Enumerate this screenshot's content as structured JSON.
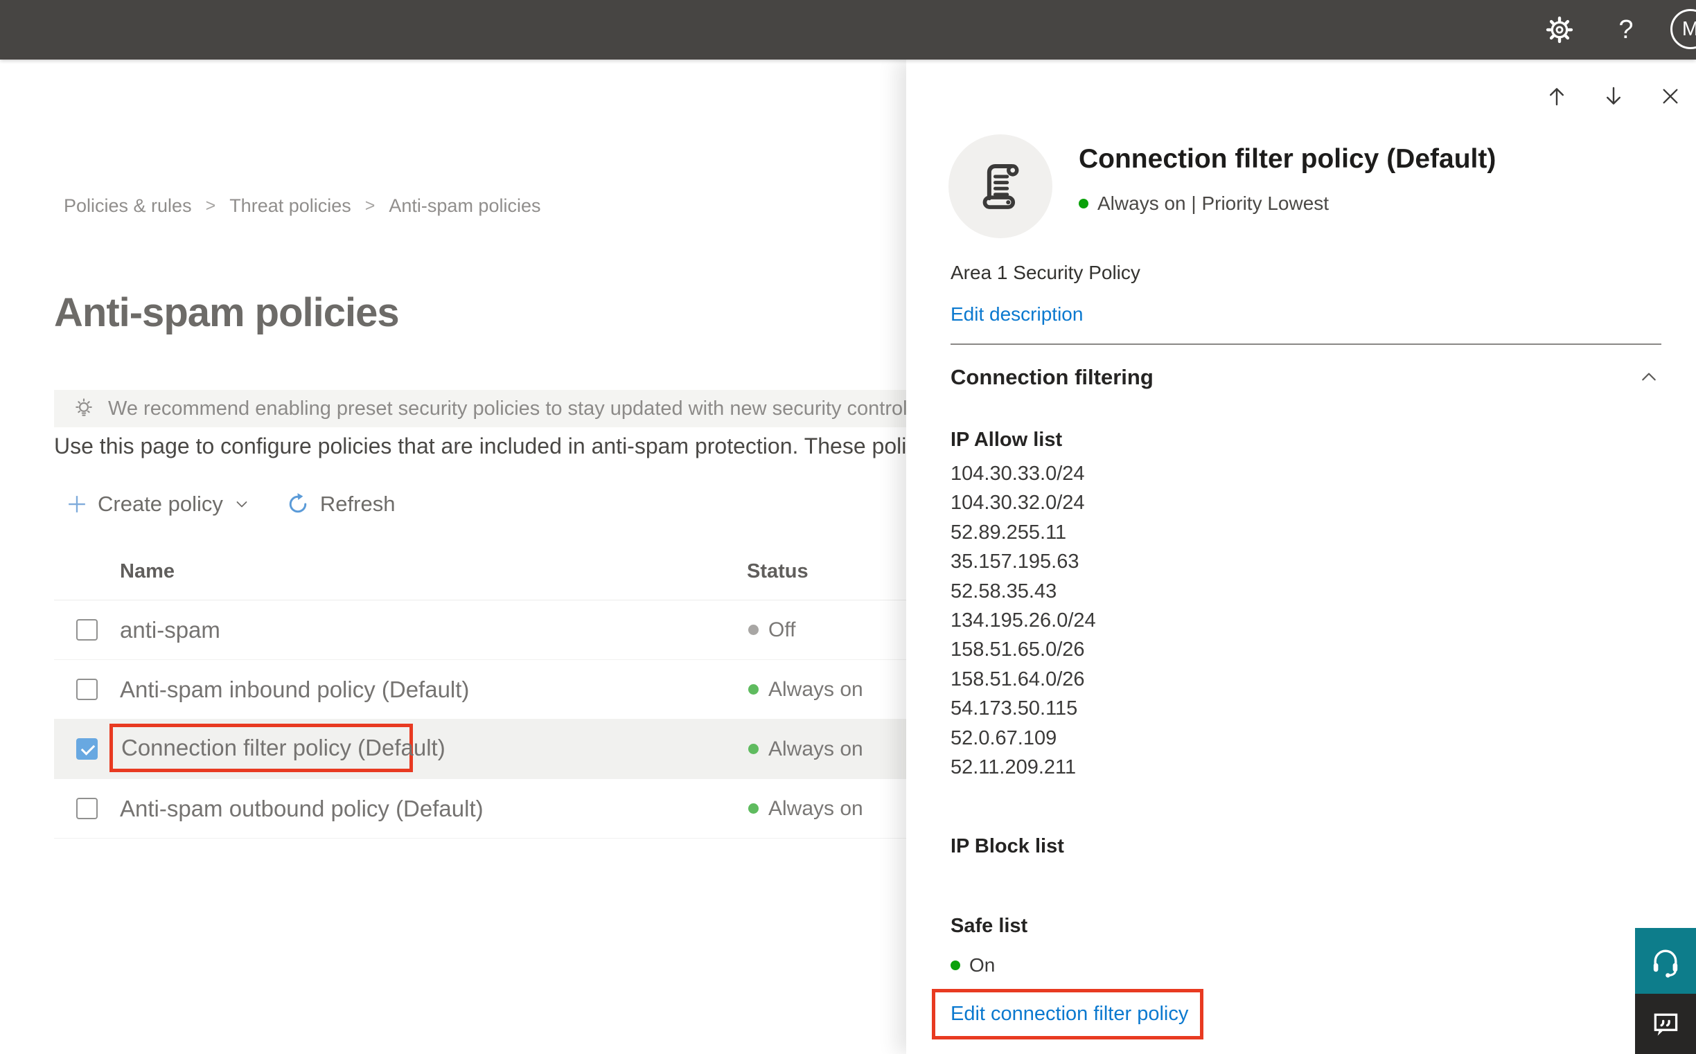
{
  "topbar": {
    "help_glyph": "?",
    "avatar_initial": "M"
  },
  "breadcrumb": {
    "separator": ">",
    "items": [
      "Policies & rules",
      "Threat policies",
      "Anti-spam policies"
    ]
  },
  "page": {
    "title": "Anti-spam policies",
    "banner_text": "We recommend enabling preset security policies to stay updated with new security controls and our recomme",
    "description": "Use this page to configure policies that are included in anti-spam protection. These policies include",
    "toolbar": {
      "create_policy_label": "Create policy",
      "refresh_label": "Refresh"
    }
  },
  "table": {
    "columns": {
      "name": "Name",
      "status": "Status"
    },
    "rows": [
      {
        "name": "anti-spam",
        "status": "Off",
        "dot": "gray",
        "selected": false
      },
      {
        "name": "Anti-spam inbound policy (Default)",
        "status": "Always on",
        "dot": "green",
        "selected": false
      },
      {
        "name": "Connection filter policy (Default)",
        "status": "Always on",
        "dot": "green",
        "selected": true
      },
      {
        "name": "Anti-spam outbound policy (Default)",
        "status": "Always on",
        "dot": "green",
        "selected": false
      }
    ]
  },
  "panel": {
    "title": "Connection filter policy (Default)",
    "status_line": "Always on | Priority Lowest",
    "description": "Area 1 Security Policy",
    "edit_description_label": "Edit description",
    "section_title": "Connection filtering",
    "ip_allow_title": "IP Allow list",
    "ip_allow_list": [
      "104.30.33.0/24",
      "104.30.32.0/24",
      "52.89.255.11",
      "35.157.195.63",
      "52.58.35.43",
      "134.195.26.0/24",
      "158.51.65.0/26",
      "158.51.64.0/26",
      "54.173.50.115",
      "52.0.67.109",
      "52.11.209.211"
    ],
    "ip_block_title": "IP Block list",
    "safe_list_title": "Safe list",
    "safe_list_status": "On",
    "edit_link_label": "Edit connection filter policy"
  },
  "colors": {
    "accent_blue": "#0b79cf",
    "status_green_panel": "#0aa10a",
    "status_green_table": "#5fbb5f",
    "status_gray": "#a8a6a4",
    "annotation_red": "#e83a21",
    "support_teal": "#0d7d8b",
    "topbar_gray": "#474543"
  }
}
